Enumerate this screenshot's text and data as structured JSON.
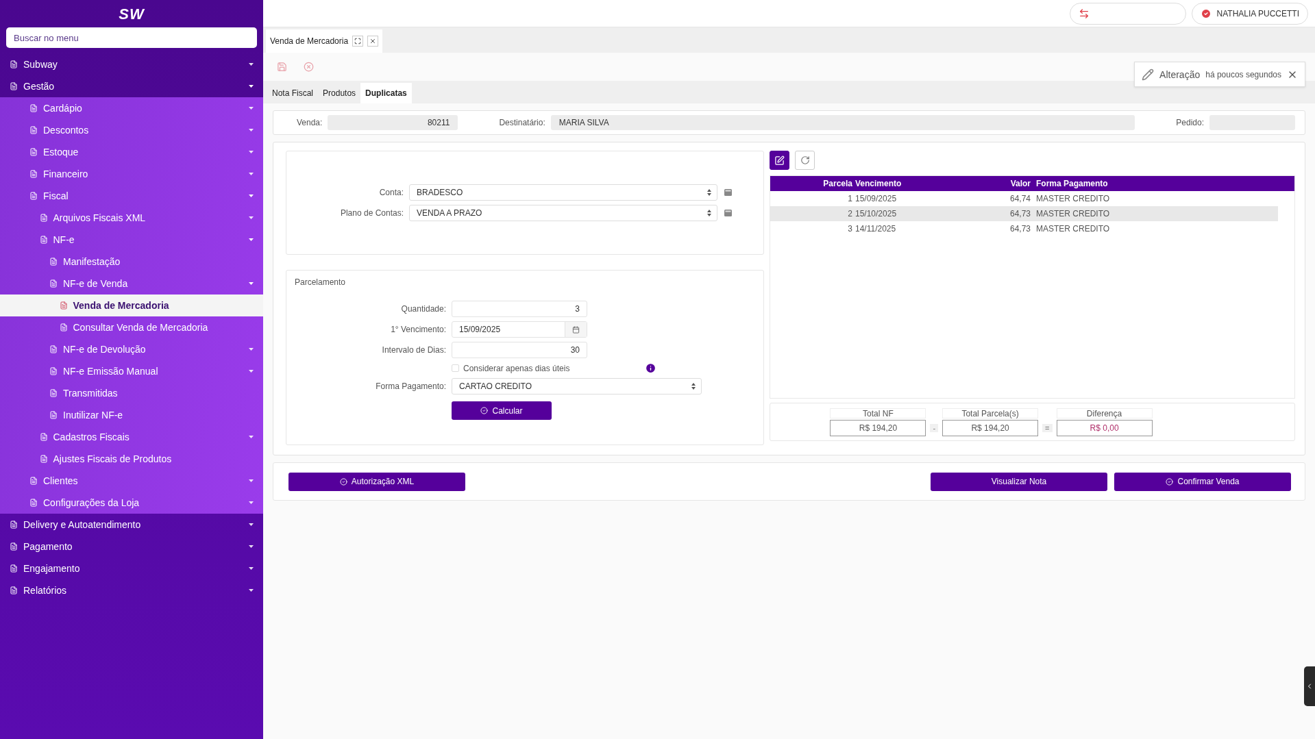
{
  "sidebar": {
    "logo": "SW",
    "search": {
      "placeholder": "Buscar no menu"
    },
    "items": [
      {
        "label": "Subway",
        "expanded": false
      },
      {
        "label": "Gestão",
        "expanded": true,
        "children": [
          {
            "label": "Cardápio",
            "expanded": false
          },
          {
            "label": "Descontos",
            "expanded": false
          },
          {
            "label": "Estoque",
            "expanded": false
          },
          {
            "label": "Financeiro",
            "expanded": false
          },
          {
            "label": "Fiscal",
            "expanded": true,
            "children": [
              {
                "label": "Arquivos Fiscais XML",
                "expanded": false
              },
              {
                "label": "NF-e",
                "expanded": true,
                "children": [
                  {
                    "label": "Manifestação",
                    "selected": false
                  },
                  {
                    "label": "NF-e de Venda",
                    "expanded": true,
                    "children": [
                      {
                        "label": "Venda de Mercadoria",
                        "selected": true
                      },
                      {
                        "label": "Consultar Venda de Mercadoria",
                        "selected": false
                      }
                    ]
                  },
                  {
                    "label": "NF-e de Devolução",
                    "expanded": false
                  },
                  {
                    "label": "NF-e Emissão Manual",
                    "expanded": false
                  },
                  {
                    "label": "Transmitidas",
                    "selected": false
                  },
                  {
                    "label": "Inutilizar NF-e",
                    "selected": false
                  }
                ]
              },
              {
                "label": "Cadastros Fiscais",
                "expanded": false
              },
              {
                "label": "Ajustes Fiscais de Produtos",
                "selected": false
              }
            ]
          },
          {
            "label": "Clientes",
            "expanded": false
          },
          {
            "label": "Configurações da Loja",
            "expanded": false
          }
        ]
      },
      {
        "label": "Delivery e Autoatendimento",
        "expanded": false
      },
      {
        "label": "Pagamento",
        "expanded": false
      },
      {
        "label": "Engajamento",
        "expanded": false
      },
      {
        "label": "Relatórios",
        "expanded": false
      }
    ]
  },
  "header": {
    "user": "NATHALIA PUCCETTI"
  },
  "doc_tabs": [
    {
      "label": "Venda de Mercadoria",
      "selected": true
    }
  ],
  "notification": {
    "title": "Alteração",
    "time": "há poucos segundos"
  },
  "form_tabs": [
    {
      "label": "Nota Fiscal",
      "selected": false
    },
    {
      "label": "Produtos",
      "selected": false
    },
    {
      "label": "Duplicatas",
      "selected": true
    }
  ],
  "summary": [
    {
      "label": "Venda:",
      "value": "80211",
      "kind": "number"
    },
    {
      "label": "Destinatário:",
      "value": "MARIA SILVA",
      "kind": "wide"
    },
    {
      "label": "Pedido:",
      "kind": "short"
    }
  ],
  "account": [
    {
      "label": "Conta:",
      "value": "BRADESCO"
    },
    {
      "label": "Plano de Contas:",
      "value": "VENDA A PRAZO"
    }
  ],
  "installments": {
    "title": "Parcelamento",
    "fields": [
      {
        "kind": "number",
        "label": "Quantidade:",
        "value": "3"
      },
      {
        "kind": "date",
        "label": "1° Vencimento:",
        "value": "15/09/2025"
      },
      {
        "kind": "number",
        "label": "Intervalo de Dias:",
        "value": "30"
      },
      {
        "kind": "checkbox",
        "label": "Considerar apenas dias úteis",
        "checked": false
      },
      {
        "kind": "select",
        "label": "Forma Pagamento:",
        "value": "CARTAO CREDITO"
      }
    ],
    "button": "Calcular"
  },
  "table": {
    "columns": [
      "Parcela",
      "Vencimento",
      "Valor",
      "Forma Pagamento"
    ],
    "rows": [
      {
        "cells": [
          "1",
          "15/09/2025",
          "64,74",
          "MASTER CREDITO"
        ],
        "selected": false
      },
      {
        "cells": [
          "2",
          "15/10/2025",
          "64,73",
          "MASTER CREDITO"
        ],
        "selected": true
      },
      {
        "cells": [
          "3",
          "14/11/2025",
          "64,73",
          "MASTER CREDITO"
        ],
        "selected": false
      }
    ]
  },
  "totals": [
    {
      "label": "Total NF",
      "value": "R$ 194,20",
      "kind": "amount"
    },
    {
      "label": "Total Parcela(s)",
      "value": "R$ 194,20",
      "kind": "amount"
    },
    {
      "label": "Diferença",
      "value": "R$ 0,00",
      "kind": "difference"
    }
  ],
  "operators": [
    "-",
    "="
  ],
  "actions_left": [
    {
      "label": "Autorização XML",
      "kind": "check"
    }
  ],
  "actions_right": [
    {
      "label": "Visualizar Nota",
      "kind": "plain"
    },
    {
      "label": "Confirmar Venda",
      "kind": "check"
    }
  ]
}
